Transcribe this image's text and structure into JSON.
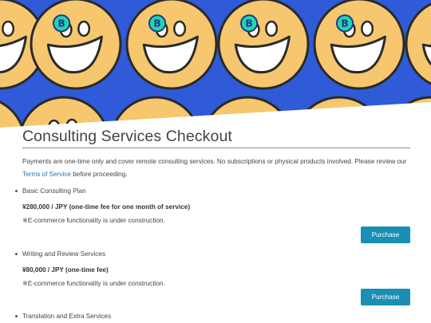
{
  "hero": {
    "background_color": "#2f5bd8",
    "face_color": "#f6c76e",
    "badge_letter": "B",
    "badge_color": "#22d6b0"
  },
  "page": {
    "title": "Consulting Services Checkout",
    "intro_text": "Payments are one-time only and cover remote consulting services. No subscriptions or physical products involved. Please review our ",
    "terms_link": "Terms of Service",
    "intro_suffix": " before proceeding."
  },
  "items": [
    {
      "name": "Basic Consulting Plan",
      "price": "¥280,000 / JPY (one-time fee for one month of service)",
      "note": "※E-commerce functionality is under construction.",
      "button": "Purchase"
    },
    {
      "name": "Writing and Review Services",
      "price": "¥80,000 / JPY (one-time fee)",
      "note": "※E-commerce functionality is under construction.",
      "button": "Purchase"
    },
    {
      "name": "Translation and Extra Services"
    }
  ],
  "colors": {
    "accent_button": "#1a8fb5",
    "link": "#1f73b7"
  }
}
